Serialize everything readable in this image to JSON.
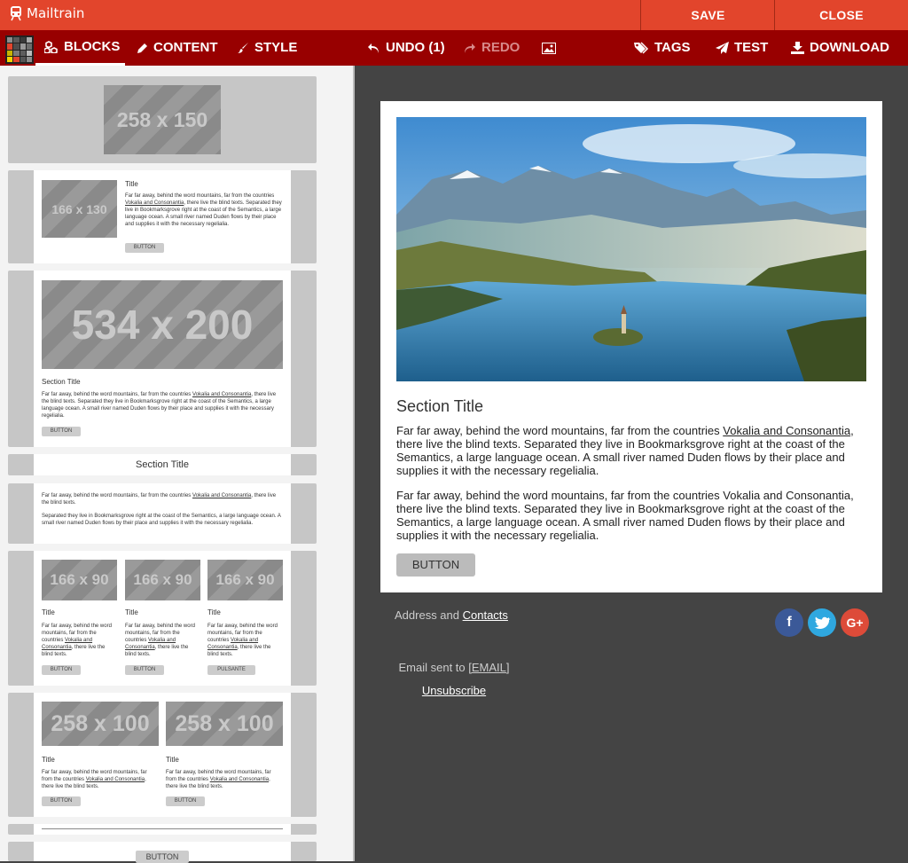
{
  "app": {
    "name": "Mailtrain"
  },
  "topbar": {
    "save": "SAVE",
    "close": "CLOSE"
  },
  "toolbar": {
    "blocks": "BLOCKS",
    "content": "CONTENT",
    "style": "STYLE",
    "undo": "UNDO (1)",
    "redo": "REDO",
    "tags": "TAGS",
    "test": "TEST",
    "download": "DOWNLOAD"
  },
  "blocks": {
    "b1": {
      "placeholder": "258 x 150"
    },
    "b2": {
      "placeholder": "166 x 130",
      "title": "Title",
      "text_a": "Far far away, behind the word mountains, far from the countries ",
      "link": "Vokalia and Consonantia",
      "text_b": ", there live the blind texts. Separated they live in Bookmarksgrove right at the coast of the Semantics, a large language ocean. A small river named Duden flows by their place and supplies it with the necessary regelialia.",
      "button": "BUTTON"
    },
    "b3": {
      "placeholder": "534 x 200",
      "title": "Section Title",
      "text_a": "Far far away, behind the word mountains, far from the countries ",
      "link": "Vokalia and Consonantia",
      "text_b": ", there live the blind texts. Separated they live in Bookmarksgrove right at the coast of the Semantics, a large language ocean. A small river named Duden flows by their place and supplies it with the necessary regelialia.",
      "button": "BUTTON"
    },
    "b4": {
      "title": "Section Title"
    },
    "b5": {
      "text_a": "Far far away, behind the word mountains, far from the countries ",
      "link": "Vokalia and Consonantia",
      "text_b": ", there live the blind texts.",
      "text_c": "Separated they live in Bookmarksgrove right at the coast of the Semantics, a large language ocean. A small river named Duden flows by their place and supplies it with the necessary regelialia."
    },
    "b6": {
      "cols": [
        {
          "placeholder": "166 x 90",
          "title": "Title",
          "text_a": "Far far away, behind the word mountains, far from the countries ",
          "link": "Vokalia and Consonantia",
          "text_b": ", there live the blind texts.",
          "button": "BUTTON"
        },
        {
          "placeholder": "166 x 90",
          "title": "Title",
          "text_a": "Far far away, behind the word mountains, far from the countries ",
          "link": "Vokalia and Consonantia",
          "text_b": ", there live the blind texts.",
          "button": "BUTTON"
        },
        {
          "placeholder": "166 x 90",
          "title": "Title",
          "text_a": "Far far away, behind the word mountains, far from the countries ",
          "link": "Vokalia and Consonantia",
          "text_b": ", there live the blind texts.",
          "button": "PULSANTE"
        }
      ]
    },
    "b7": {
      "cols": [
        {
          "placeholder": "258 x 100",
          "title": "Title",
          "text_a": "Far far away, behind the word mountains, far from the countries ",
          "link": "Vokalia and Consonantia",
          "text_b": ", there live the blind texts.",
          "button": "BUTTON"
        },
        {
          "placeholder": "258 x 100",
          "title": "Title",
          "text_a": "Far far away, behind the word mountains, far from the countries ",
          "link": "Vokalia and Consonantia",
          "text_b": ", there live the blind texts.",
          "button": "BUTTON"
        }
      ]
    },
    "b9": {
      "button": "BUTTON"
    }
  },
  "email": {
    "section_title": "Section Title",
    "p1_a": "Far far away, behind the word mountains, far from the countries ",
    "p1_link": "Vokalia and Consonantia",
    "p1_b": ", there live the blind texts. Separated they live in Bookmarksgrove right at the coast of the Semantics, a large language ocean. A small river named Duden flows by their place and supplies it with the necessary regelialia.",
    "p2": "Far far away, behind the word mountains, far from the countries Vokalia and Consonantia, there live the blind texts. Separated they live in Bookmarksgrove right at the coast of the Semantics, a large language ocean. A small river named Duden flows by their place and supplies it with the necessary regelialia.",
    "button": "BUTTON"
  },
  "footer": {
    "address": "Address and ",
    "contacts": "Contacts",
    "sent_to": "Email sent to ",
    "email_tag": "[EMAIL]",
    "unsubscribe": "Unsubscribe",
    "social_icons": [
      "facebook-icon",
      "twitter-icon",
      "google-plus-icon"
    ]
  },
  "colors": {
    "accent": "#e2452c",
    "toolbar": "#980000",
    "canvas": "#444444"
  }
}
